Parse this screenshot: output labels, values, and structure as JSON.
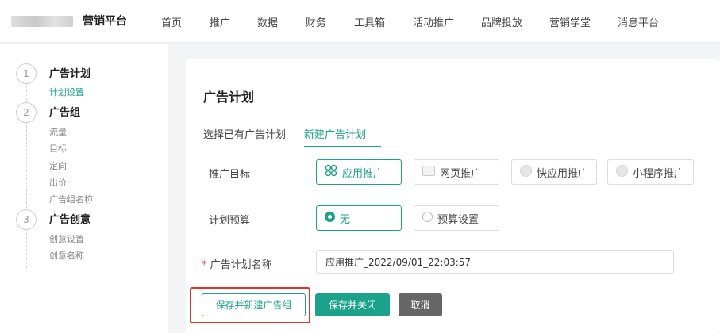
{
  "topbar": {
    "brand": "营销平台",
    "nav": [
      "首页",
      "推广",
      "数据",
      "财务",
      "工具箱",
      "活动推广",
      "品牌投放",
      "营销学堂",
      "消息平台"
    ]
  },
  "sidebar": {
    "steps": [
      {
        "number": "1",
        "title": "广告计划",
        "subs": [
          {
            "label": "计划设置",
            "active": true
          }
        ]
      },
      {
        "number": "2",
        "title": "广告组",
        "subs": [
          {
            "label": "流量"
          },
          {
            "label": "目标"
          },
          {
            "label": "定向"
          },
          {
            "label": "出价"
          },
          {
            "label": "广告组名称"
          }
        ]
      },
      {
        "number": "3",
        "title": "广告创意",
        "subs": [
          {
            "label": "创意设置"
          },
          {
            "label": "创意名称"
          }
        ]
      }
    ]
  },
  "main": {
    "title": "广告计划",
    "tabs": [
      {
        "label": "选择已有广告计划",
        "active": false
      },
      {
        "label": "新建广告计划",
        "active": true
      }
    ],
    "target": {
      "label": "推广目标",
      "options": [
        "应用推广",
        "网页推广",
        "快应用推广",
        "小程序推广"
      ],
      "selected": "应用推广"
    },
    "budget": {
      "label": "计划预算",
      "options": [
        "无",
        "预算设置"
      ],
      "selected": "无"
    },
    "plan_name": {
      "required_mark": "*",
      "label": "广告计划名称",
      "value": "应用推广_2022/09/01_22:03:57"
    },
    "buttons": {
      "save_new_group": "保存并新建广告组",
      "save_close": "保存并关闭",
      "cancel": "取消"
    }
  },
  "colors": {
    "accent": "#1aa38a",
    "highlight": "#e8302a",
    "cancel_bg": "#666666"
  }
}
